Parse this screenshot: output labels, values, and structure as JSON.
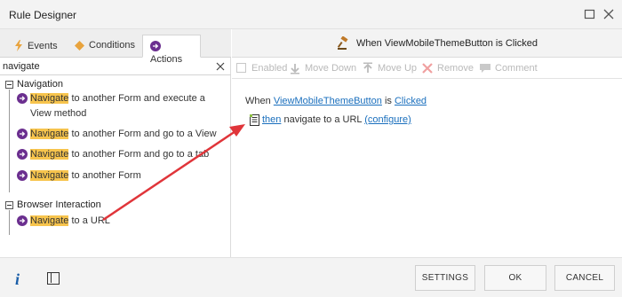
{
  "window": {
    "title": "Rule Designer"
  },
  "tabs": [
    {
      "label": "Events",
      "icon": "lightning-icon"
    },
    {
      "label": "Conditions",
      "icon": "diamond-icon"
    },
    {
      "label": "Actions",
      "icon": "arrow-circle-icon",
      "active": true
    }
  ],
  "search": {
    "value": "navigate"
  },
  "tree": {
    "groups": [
      {
        "label": "Navigation",
        "items": [
          {
            "highlight": "Navigate",
            "rest": " to another Form and execute a View method"
          },
          {
            "highlight": "Navigate",
            "rest": " to another Form and go to a View"
          },
          {
            "highlight": "Navigate",
            "rest": " to another Form and go to a tab"
          },
          {
            "highlight": "Navigate",
            "rest": " to another Form"
          }
        ]
      },
      {
        "label": "Browser Interaction",
        "items": [
          {
            "highlight": "Navigate",
            "rest": " to a URL"
          }
        ]
      }
    ]
  },
  "rule_header": {
    "title": "When ViewMobileThemeButton is Clicked",
    "icon": "gavel-icon"
  },
  "toolbar": {
    "enabled": "Enabled",
    "move_down": "Move Down",
    "move_up": "Move Up",
    "remove": "Remove",
    "comment": "Comment"
  },
  "rule": {
    "when": "When",
    "control": "ViewMobileThemeButton",
    "is": "is",
    "event": "Clicked",
    "then": "then",
    "action_text": "navigate to a URL",
    "configure": "(configure)"
  },
  "footer": {
    "info": "i",
    "settings": "SETTINGS",
    "ok": "OK",
    "cancel": "CANCEL"
  },
  "colors": {
    "accent_link": "#1a6fbd",
    "highlight": "#f7c44d",
    "action_icon": "#6b2f8f",
    "annotation_arrow": "#e0353a"
  }
}
